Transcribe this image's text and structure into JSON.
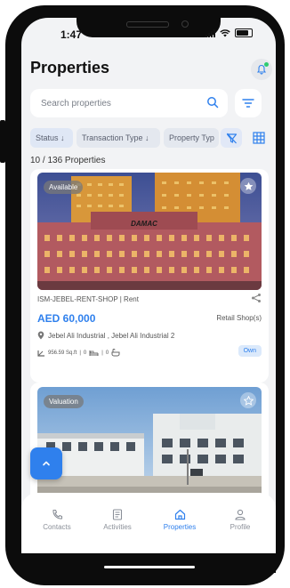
{
  "status_bar": {
    "time": "1:47"
  },
  "header": {
    "title": "Properties"
  },
  "search": {
    "placeholder": "Search properties"
  },
  "filters": {
    "status": "Status ↓",
    "transaction_type": "Transaction Type ↓",
    "property_type": "Property Typ"
  },
  "results": {
    "count_text": "10 / 136 Properties"
  },
  "listings": [
    {
      "badge": "Available",
      "reference": "ISM-JEBEL-RENT-SHOP | Rent",
      "price": "AED 60,000",
      "category": "Retail  Shop(s)",
      "location": "Jebel Ali Industrial , Jebel Ali Industrial 2",
      "area": "956.59 Sq.ft",
      "bedrooms": "0",
      "bathrooms": "0",
      "ownership": "Own",
      "building_sign": "DAMAC"
    },
    {
      "badge": "Valuation"
    }
  ],
  "bottom_nav": {
    "items": [
      {
        "label": "Contacts",
        "icon": "phone-icon"
      },
      {
        "label": "Activities",
        "icon": "document-icon"
      },
      {
        "label": "Properties",
        "icon": "home-icon",
        "active": true
      },
      {
        "label": "Profile",
        "icon": "user-icon"
      }
    ]
  },
  "colors": {
    "accent": "#2f80ed",
    "background": "#f2f3f5",
    "frame": "#0c0c0c"
  }
}
